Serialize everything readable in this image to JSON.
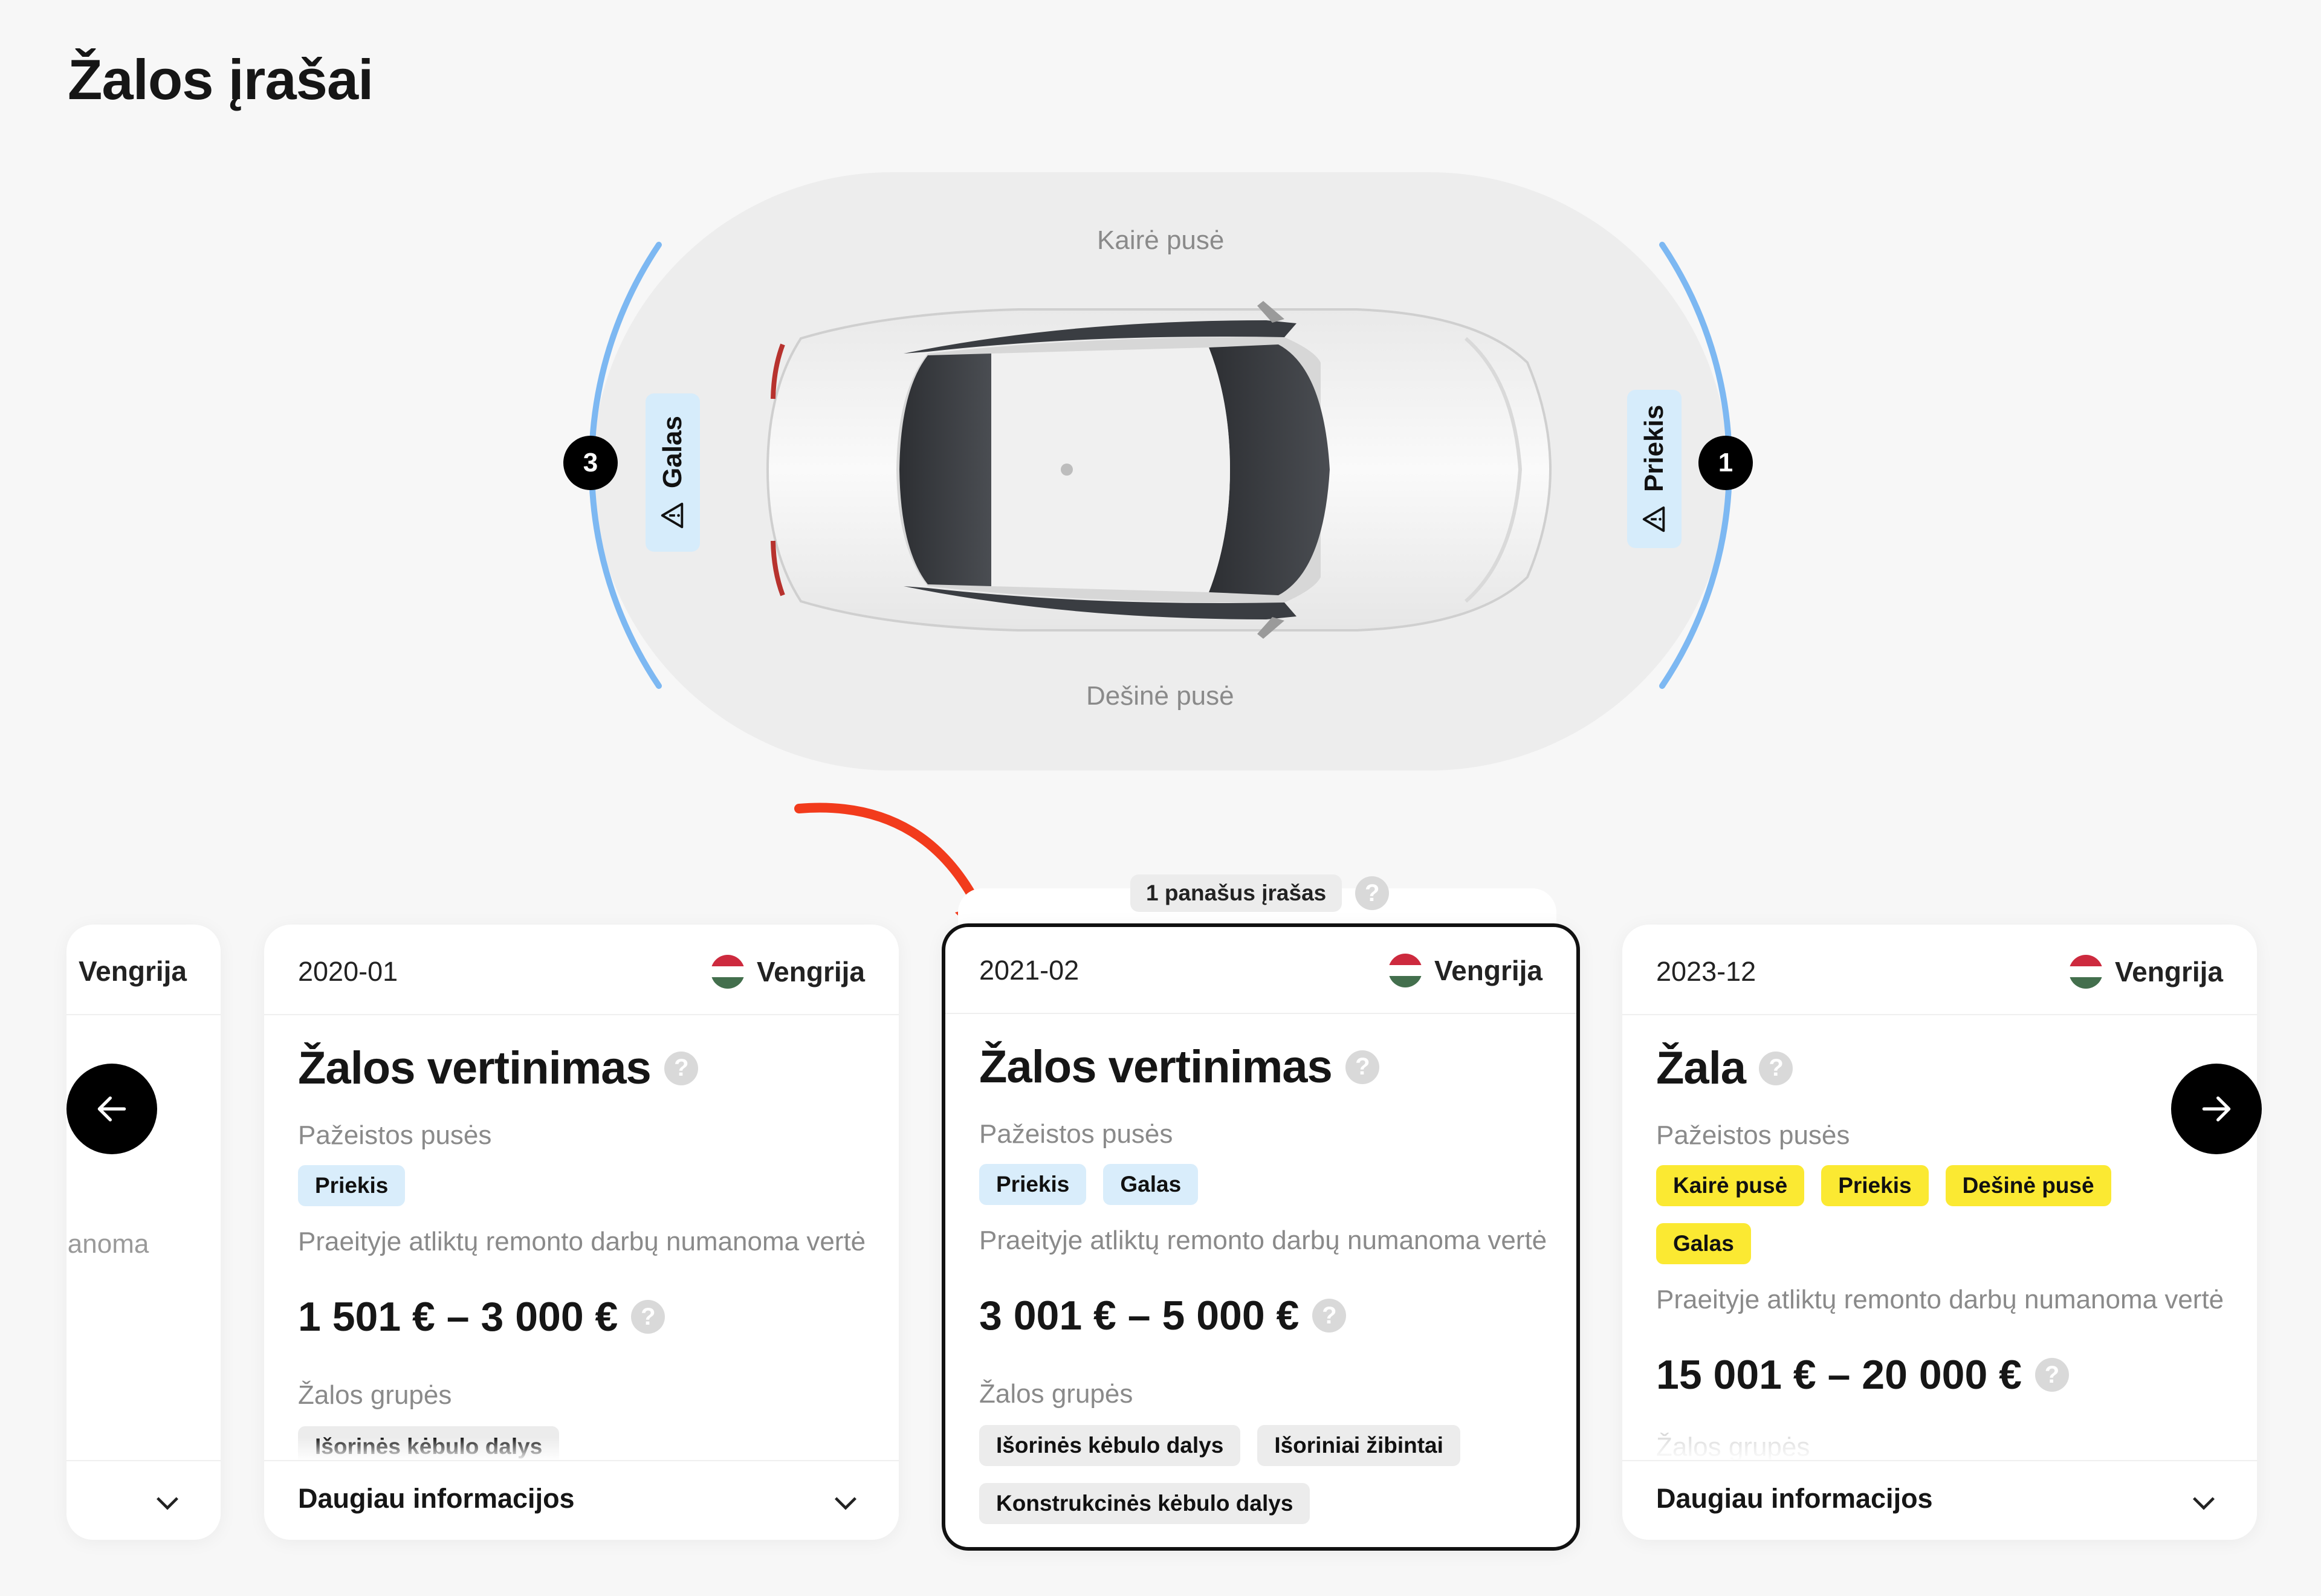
{
  "page": {
    "title": "Žalos įrašai"
  },
  "diagram": {
    "top_label": "Kairė pusė",
    "bottom_label": "Dešinė pusė",
    "left_zone": {
      "number": "3",
      "label": "Galas"
    },
    "right_zone": {
      "number": "1",
      "label": "Priekis"
    },
    "arc_color": "#7db8f2",
    "icons": {
      "warning": "warning-triangle-icon",
      "car": "car-top-view"
    }
  },
  "similar": {
    "label": "1 panašus įrašas",
    "help": "?"
  },
  "common": {
    "affected_label": "Pažeistos pusės",
    "repair_label": "Praeityje atliktų remonto darbų numanoma vertė",
    "groups_label": "Žalos grupės",
    "more_info": "Daugiau informacijos",
    "help": "?"
  },
  "cards": [
    {
      "partial": true,
      "country": "Vengrija",
      "fragment": "ianoma"
    },
    {
      "date": "2020-01",
      "country": "Vengrija",
      "title": "Žalos vertinimas",
      "sides": [
        "Priekis"
      ],
      "price": "1 501 € – 3 000 €",
      "groups": [
        "Išorinės kėbulo dalys"
      ]
    },
    {
      "date": "2021-02",
      "country": "Vengrija",
      "title": "Žalos vertinimas",
      "sides": [
        "Priekis",
        "Galas"
      ],
      "price": "3 001 € – 5 000 €",
      "groups": [
        "Išorinės kėbulo dalys",
        "Išoriniai žibintai",
        "Konstrukcinės kėbulo dalys"
      ]
    },
    {
      "date": "2023-12",
      "country": "Vengrija",
      "title": "Žala",
      "sides": [
        "Kairė pusė",
        "Priekis",
        "Dešinė pusė",
        "Galas"
      ],
      "price": "15 001 € – 20 000 €"
    }
  ],
  "colors": {
    "blue_tag": "#d9edfb",
    "yellow_tag": "#fbe932",
    "grey_tag": "#ececec",
    "flag_red": "#cd2a3e",
    "flag_white": "#ffffff",
    "flag_green": "#436f4d",
    "annotation_arrow": "#f23b1c"
  }
}
